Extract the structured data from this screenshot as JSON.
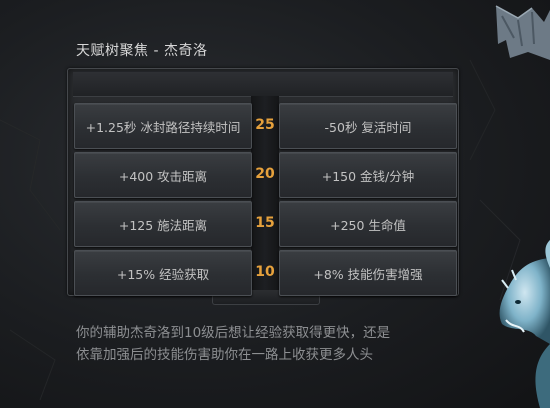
{
  "header": {
    "title": "天赋树聚焦 - 杰奇洛"
  },
  "talent_tree": {
    "rows": [
      {
        "level": "25",
        "left": "+1.25秒 冰封路径持续时间",
        "right": "-50秒 复活时间"
      },
      {
        "level": "20",
        "left": "+400 攻击距离",
        "right": "+150 金钱/分钟"
      },
      {
        "level": "15",
        "left": "+125 施法距离",
        "right": "+250 生命值"
      },
      {
        "level": "10",
        "left": "+15% 经验获取",
        "right": "+8% 技能伤害增强"
      }
    ]
  },
  "description": {
    "line1": "你的辅助杰奇洛到10级后想让经验获取得更快，还是",
    "line2": "依靠加强后的技能伤害助你在一路上收获更多人头"
  },
  "colors": {
    "level_accent": "#e6a13c",
    "background": "#1b1d20",
    "creature": "#7fb3c9"
  },
  "decor": {
    "top_right": "dragon-wing-icon",
    "bottom_right": "ice-dragon-head-icon"
  }
}
